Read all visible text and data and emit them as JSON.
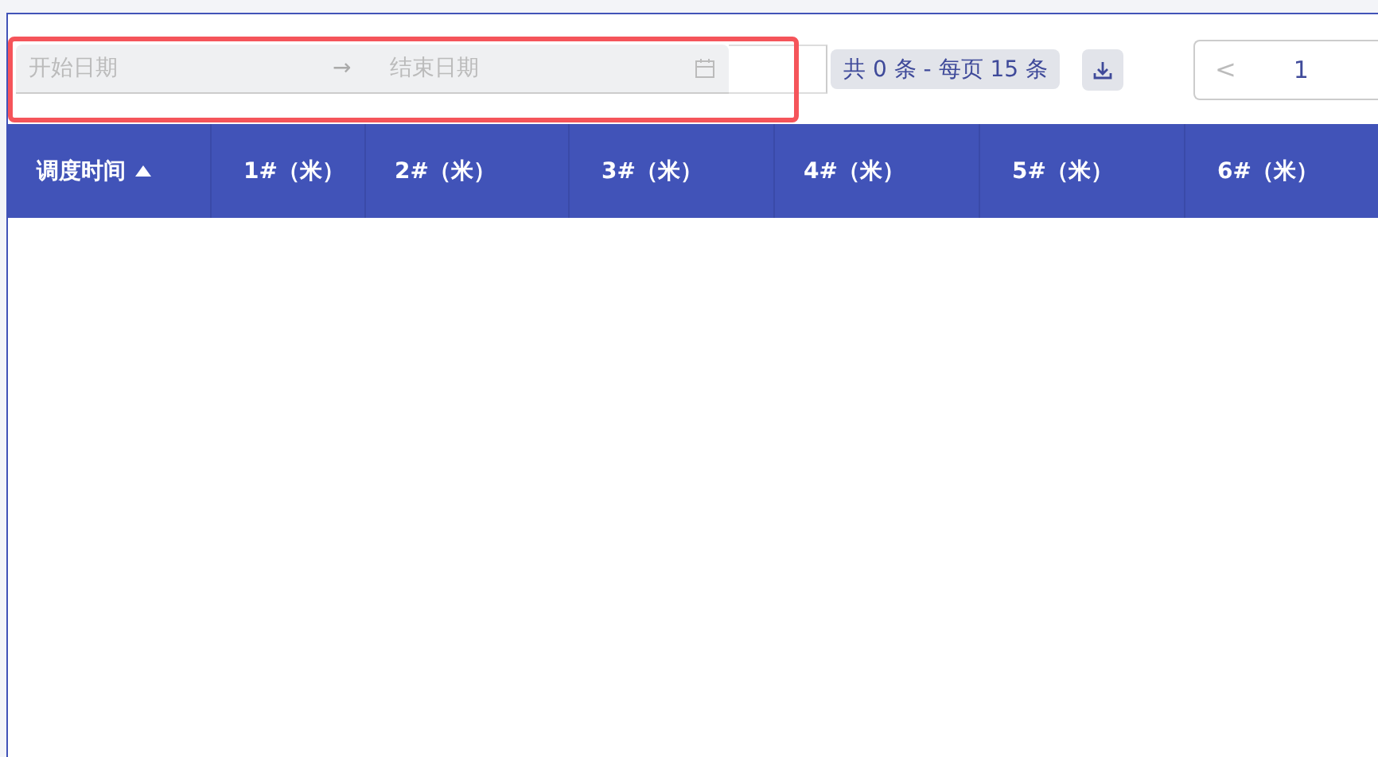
{
  "toolbar": {
    "date_range": {
      "start_placeholder": "开始日期",
      "separator": "→",
      "end_placeholder": "结束日期"
    },
    "total": "共 0 条 - 每页 15 条",
    "pager": {
      "prev": "<",
      "prev_disabled": true,
      "pages": [
        {
          "label": "1",
          "selected": true
        }
      ]
    }
  },
  "highlight": true,
  "table": {
    "columns": [
      {
        "label": "调度时间",
        "sorted_ascending": true
      },
      {
        "label": "1#（米）",
        "sorted_ascending": false
      },
      {
        "label": "2#（米）",
        "sorted_ascending": false
      },
      {
        "label": "3#（米）",
        "sorted_ascending": false
      },
      {
        "label": "4#（米）",
        "sorted_ascending": false
      },
      {
        "label": "5#（米）",
        "sorted_ascending": false
      },
      {
        "label": "6#（米）",
        "sorted_ascending": false
      }
    ]
  }
}
